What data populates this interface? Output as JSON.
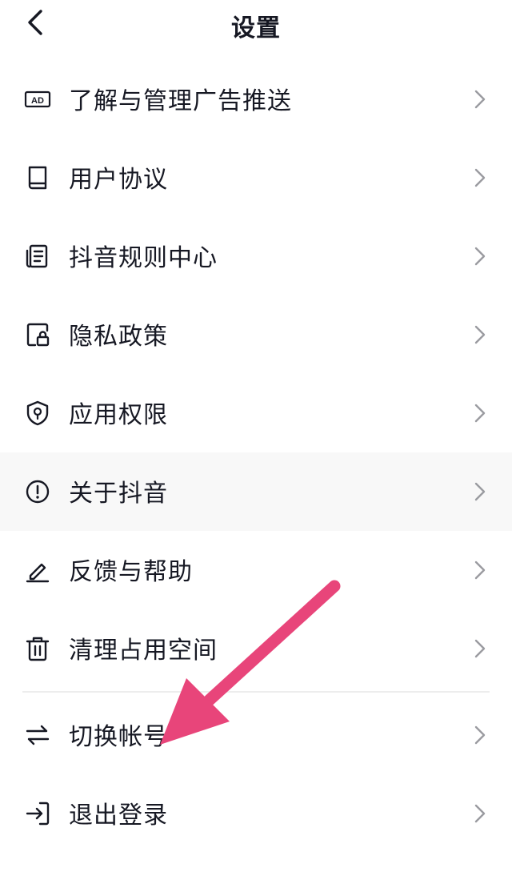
{
  "header": {
    "title": "设置"
  },
  "items_top": [
    {
      "label": "了解与管理广告推送",
      "icon": "ad-icon"
    },
    {
      "label": "用户协议",
      "icon": "book-icon"
    },
    {
      "label": "抖音规则中心",
      "icon": "document-list-icon"
    },
    {
      "label": "隐私政策",
      "icon": "lock-document-icon"
    },
    {
      "label": "应用权限",
      "icon": "shield-location-icon"
    },
    {
      "label": "关于抖音",
      "icon": "info-icon"
    },
    {
      "label": "反馈与帮助",
      "icon": "pen-icon"
    },
    {
      "label": "清理占用空间",
      "icon": "trash-icon"
    }
  ],
  "items_bottom": [
    {
      "label": "切换帐号",
      "icon": "swap-icon"
    },
    {
      "label": "退出登录",
      "icon": "logout-icon"
    }
  ],
  "annotation": {
    "arrow_color": "#e8457a"
  }
}
